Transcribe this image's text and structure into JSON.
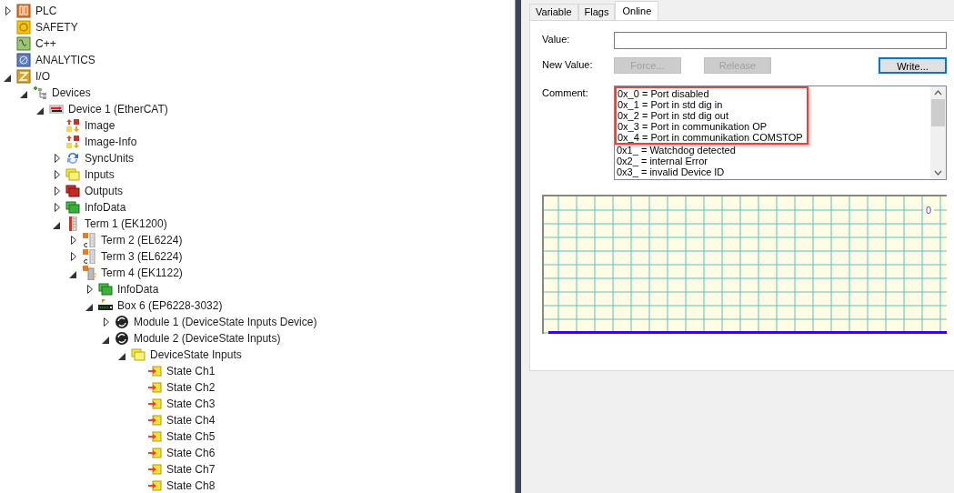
{
  "tree": [
    {
      "label": "PLC",
      "kind": "plc",
      "expanded": false
    },
    {
      "label": "SAFETY",
      "kind": "safety"
    },
    {
      "label": "C++",
      "kind": "cpp"
    },
    {
      "label": "ANALYTICS",
      "kind": "analytics"
    },
    {
      "label": "I/O",
      "kind": "io",
      "expanded": true,
      "children": [
        {
          "label": "Devices",
          "kind": "devices",
          "expanded": true,
          "children": [
            {
              "label": "Device 1 (EtherCAT)",
              "kind": "ethercat",
              "expanded": true,
              "children": [
                {
                  "label": "Image",
                  "kind": "image"
                },
                {
                  "label": "Image-Info",
                  "kind": "image"
                },
                {
                  "label": "SyncUnits",
                  "kind": "sync",
                  "expanded": false
                },
                {
                  "label": "Inputs",
                  "kind": "inputs",
                  "expanded": false
                },
                {
                  "label": "Outputs",
                  "kind": "outputs",
                  "expanded": false
                },
                {
                  "label": "InfoData",
                  "kind": "infodata",
                  "expanded": false
                },
                {
                  "label": "Term 1 (EK1200)",
                  "kind": "coupler",
                  "expanded": true,
                  "children": [
                    {
                      "label": "Term 2 (EL6224)",
                      "kind": "terminal",
                      "expanded": false
                    },
                    {
                      "label": "Term 3 (EL6224)",
                      "kind": "terminal",
                      "expanded": false
                    },
                    {
                      "label": "Term 4 (EK1122)",
                      "kind": "junction",
                      "expanded": true,
                      "children": [
                        {
                          "label": "InfoData",
                          "kind": "infodata",
                          "expanded": false
                        },
                        {
                          "label": "Box 6 (EP6228-3032)",
                          "kind": "box",
                          "expanded": true,
                          "children": [
                            {
                              "label": "Module 1 (DeviceState Inputs Device)",
                              "kind": "module",
                              "expanded": false
                            },
                            {
                              "label": "Module 2 (DeviceState Inputs)",
                              "kind": "module",
                              "expanded": true,
                              "children": [
                                {
                                  "label": "DeviceState Inputs",
                                  "kind": "inputs",
                                  "expanded": true,
                                  "children": [
                                    {
                                      "label": "State Ch1",
                                      "kind": "variable"
                                    },
                                    {
                                      "label": "State Ch2",
                                      "kind": "variable"
                                    },
                                    {
                                      "label": "State Ch3",
                                      "kind": "variable"
                                    },
                                    {
                                      "label": "State Ch4",
                                      "kind": "variable"
                                    },
                                    {
                                      "label": "State Ch5",
                                      "kind": "variable"
                                    },
                                    {
                                      "label": "State Ch6",
                                      "kind": "variable"
                                    },
                                    {
                                      "label": "State Ch7",
                                      "kind": "variable"
                                    },
                                    {
                                      "label": "State Ch8",
                                      "kind": "variable"
                                    }
                                  ]
                                }
                              ]
                            }
                          ]
                        }
                      ]
                    }
                  ]
                }
              ]
            }
          ]
        }
      ]
    }
  ],
  "tabs": [
    {
      "label": "Variable",
      "selected": false
    },
    {
      "label": "Flags",
      "selected": false
    },
    {
      "label": "Online",
      "selected": true
    }
  ],
  "value_label": "Value:",
  "new_value_label": "New Value:",
  "buttons": [
    {
      "label": "Force...",
      "disabled": true,
      "focused": false
    },
    {
      "label": "Release",
      "disabled": true,
      "focused": false
    },
    {
      "label": "Write...",
      "disabled": false,
      "focused": true
    }
  ],
  "comment_label": "Comment:",
  "comment_lines": [
    {
      "text": "0x_0 = Port disabled",
      "highlighted": true
    },
    {
      "text": "0x_1 = Port in std dig in",
      "highlighted": true
    },
    {
      "text": "0x_2 = Port in std dig out",
      "highlighted": true
    },
    {
      "text": "0x_3 = Port in communikation OP",
      "highlighted": true
    },
    {
      "text": "0x_4 = Port in communikation COMSTOP",
      "highlighted": true
    },
    {
      "text": "0x1_ = Watchdog detected",
      "highlighted": false
    },
    {
      "text": "0x2_ = internal Error",
      "highlighted": false
    },
    {
      "text": "0x3_ = invalid Device ID",
      "highlighted": false
    }
  ],
  "plot": {
    "value_label": "0"
  }
}
